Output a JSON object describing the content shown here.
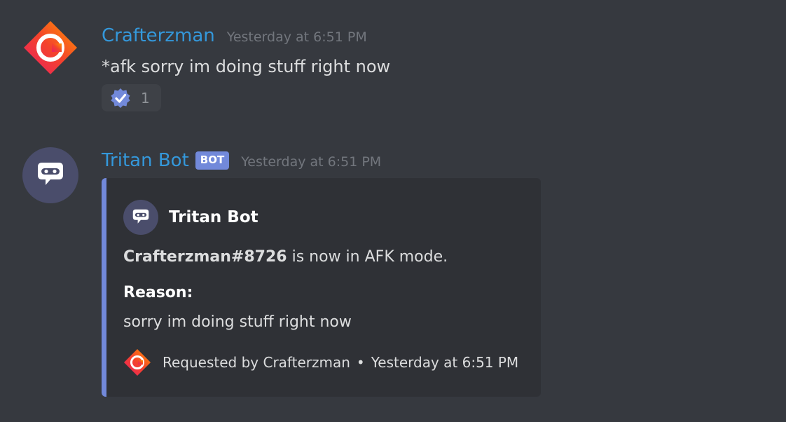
{
  "messages": [
    {
      "author": "Crafterzman",
      "timestamp": "Yesterday at 6:51 PM",
      "text": "*afk sorry im doing stuff right now",
      "avatar_icon": "crafterzman-logo-icon",
      "reaction": {
        "emoji_icon": "verified-check-badge-icon",
        "count": "1"
      }
    },
    {
      "author": "Tritan Bot",
      "bot_tag": "BOT",
      "timestamp": "Yesterday at 6:51 PM",
      "avatar_icon": "robot-chat-bubble-icon",
      "embed": {
        "accent_color": "#7289da",
        "author_name": "Tritan Bot",
        "description_bold": "Crafterzman#8726",
        "description_rest": " is now in AFK mode.",
        "field_name": "Reason:",
        "field_value": "sorry im doing stuff right now",
        "footer_requested": "Requested by Crafterzman",
        "footer_separator": "•",
        "footer_timestamp": "Yesterday at 6:51 PM"
      }
    }
  ],
  "colors": {
    "background": "#36393f",
    "username": "#3498db",
    "embed_background": "#2f3136"
  }
}
